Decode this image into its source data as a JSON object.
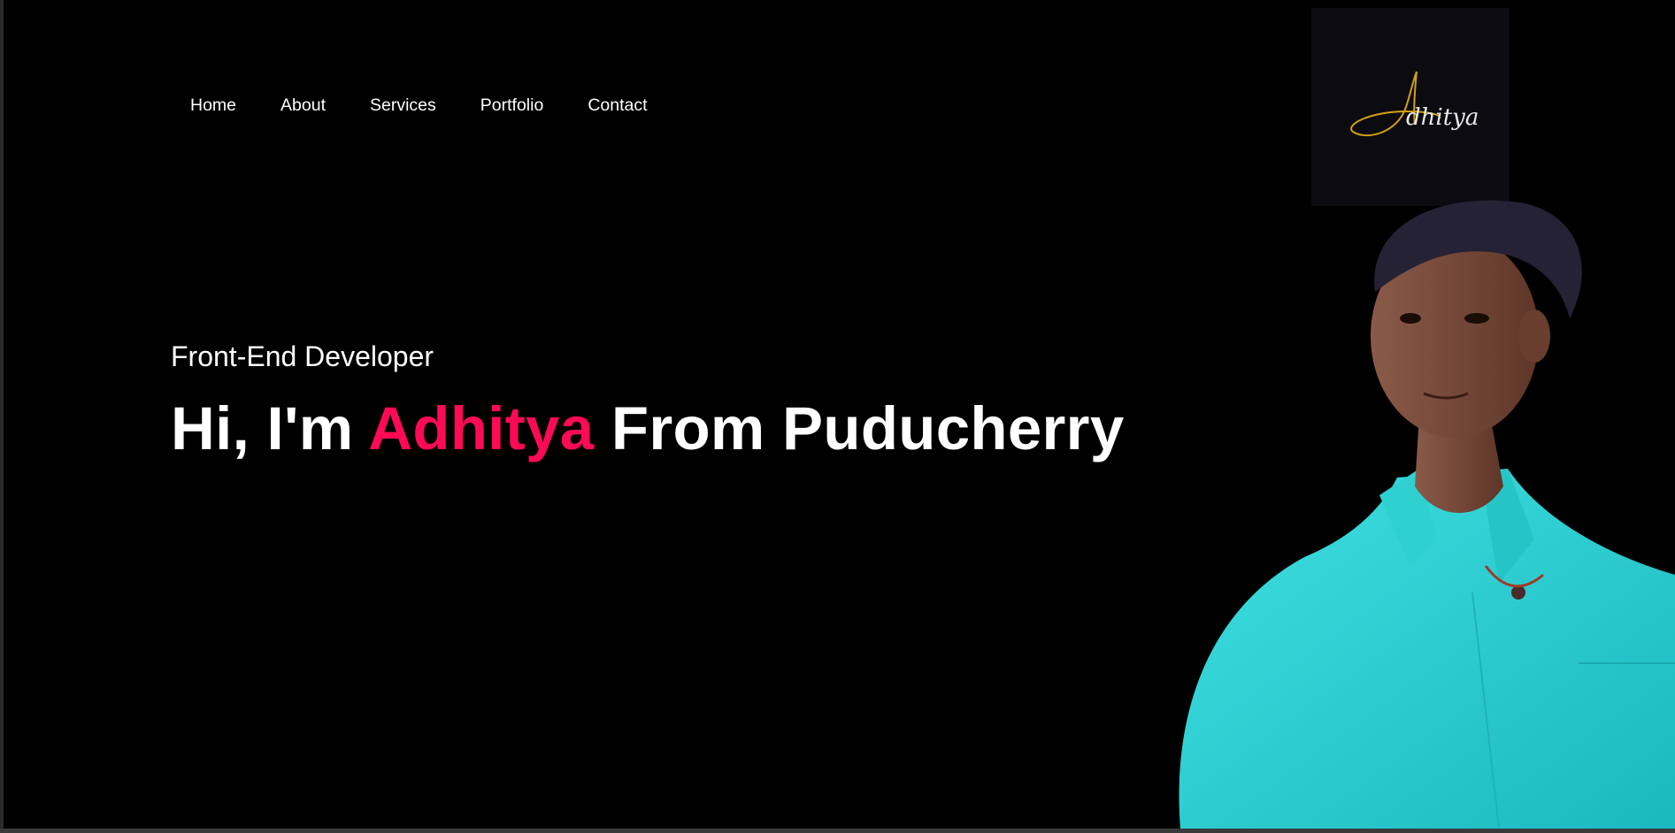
{
  "nav": {
    "items": [
      {
        "label": "Home"
      },
      {
        "label": "About"
      },
      {
        "label": "Services"
      },
      {
        "label": "Portfolio"
      },
      {
        "label": "Contact"
      }
    ]
  },
  "logo": {
    "text": "Adhitya",
    "color": "#d4a017"
  },
  "hero": {
    "subtitle": "Front-End Developer",
    "title_prefix": "Hi, I'm ",
    "title_name": "Adhitya",
    "title_suffix": " From Puducherry",
    "accent_color": "#ff0a54"
  },
  "colors": {
    "background": "#000000",
    "text": "#ffffff",
    "shirt": "#2ad4d4"
  }
}
